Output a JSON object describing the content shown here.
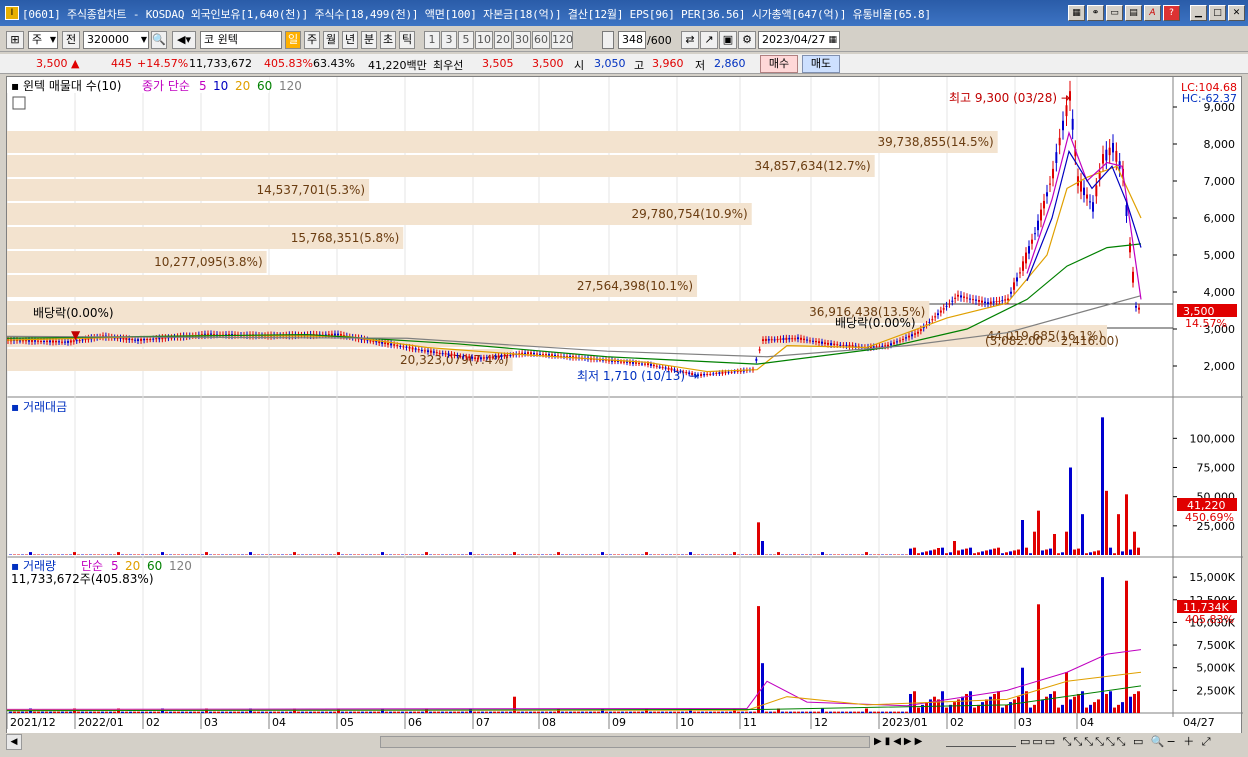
{
  "title_bar": {
    "icon": "app-logo-icon",
    "text": "[0601] 주식종합차트 - KOSDAQ 외국인보유[1,640(천)] 주식수[18,499(천)] 액면[100] 자본금[18(억)] 결산[12월] EPS[96] PER[36.56] 시가총액[647(억)] 유통비율[65.8]",
    "buttons": [
      "layout-icon",
      "link-icon",
      "window-icon",
      "print-icon",
      "font-icon",
      "help-icon",
      "minimize-icon",
      "maximize-icon",
      "close-icon"
    ]
  },
  "toolbar": {
    "period_select": "주",
    "prev_label": "전",
    "code": "320000",
    "name": "윈텍",
    "market_tag": "코",
    "interval_buttons": [
      "일",
      "주",
      "월",
      "년",
      "분",
      "초",
      "틱"
    ],
    "active_interval": "일",
    "minute_buttons": [
      "1",
      "3",
      "5",
      "10",
      "20",
      "30",
      "60",
      "120"
    ],
    "count_value": "348",
    "count_total": "/600",
    "date": "2023/04/27"
  },
  "quote": {
    "price": "3,500",
    "change": "445",
    "change_pct": "+14.57%",
    "volume": "11,733,672",
    "volume_pct": "405.83%",
    "turnover": "63.43%",
    "amount": "41,220백만",
    "best_label": "최우선",
    "ask": "3,505",
    "bid": "3,500",
    "open_label": "시",
    "open": "3,050",
    "high_label": "고",
    "high": "3,960",
    "low_label": "저",
    "low": "2,860",
    "buy_label": "매수",
    "sell_label": "매도"
  },
  "price_panel": {
    "legend_name": "윈텍 매물대 수(10)",
    "ma_label": "종가 단순",
    "ma_periods": [
      "5",
      "10",
      "20",
      "60",
      "120"
    ],
    "ma_colors": [
      "#c000c0",
      "#0000c0",
      "#e0a000",
      "#008000",
      "#808080"
    ],
    "lc": "LC:104.68",
    "hc": "HC:-62.37",
    "y_ticks": [
      "9,000",
      "8,000",
      "7,000",
      "6,000",
      "5,000",
      "4,000",
      "3,000",
      "2,000"
    ],
    "current_price_tag": "3,500",
    "current_pct_tag": "14.57%",
    "high_annotation": "최고 9,300 (03/28)",
    "low_annotation": "최저 1,710 (10/13)",
    "dividend_label_1": "배당락(0.00%)",
    "dividend_label_2": "배당락(0.00%)",
    "range_text": "(3,082.00 ~ 2,416.00)",
    "volume_profile": [
      {
        "label": "39,738,855(14.5%)",
        "fraction": 0.145
      },
      {
        "label": "34,857,634(12.7%)",
        "fraction": 0.127
      },
      {
        "label": "14,537,701(5.3%)",
        "fraction": 0.053
      },
      {
        "label": "29,780,754(10.9%)",
        "fraction": 0.109
      },
      {
        "label": "15,768,351(5.8%)",
        "fraction": 0.058
      },
      {
        "label": "10,277,095(3.8%)",
        "fraction": 0.038
      },
      {
        "label": "27,564,398(10.1%)",
        "fraction": 0.101
      },
      {
        "label": "36,916,438(13.5%)",
        "fraction": 0.135
      },
      {
        "label": "44,019,685(16.1%)",
        "fraction": 0.161
      },
      {
        "label": "20,323,079(7.4%)",
        "fraction": 0.074
      }
    ]
  },
  "amount_panel": {
    "title": "거래대금",
    "y_ticks": [
      "100,000",
      "75,000",
      "50,000",
      "25,000"
    ],
    "value_tag": "41,220",
    "pct_tag": "450.69%"
  },
  "volume_panel": {
    "title": "거래량",
    "ma_label": "단순",
    "ma_periods": [
      "5",
      "20",
      "60",
      "120"
    ],
    "sub_value": "11,733,672주(405.83%)",
    "y_ticks": [
      "15,000K",
      "12,500K",
      "10,000K",
      "7,500K",
      "5,000K",
      "2,500K"
    ],
    "value_tag": "11,734K",
    "pct_tag": "405.83%"
  },
  "x_axis": {
    "labels": [
      "2021/12",
      "2022/01",
      "02",
      "03",
      "04",
      "05",
      "06",
      "07",
      "08",
      "09",
      "10",
      "11",
      "12",
      "2023/01",
      "02",
      "03",
      "04"
    ],
    "last_date": "04/27"
  }
}
